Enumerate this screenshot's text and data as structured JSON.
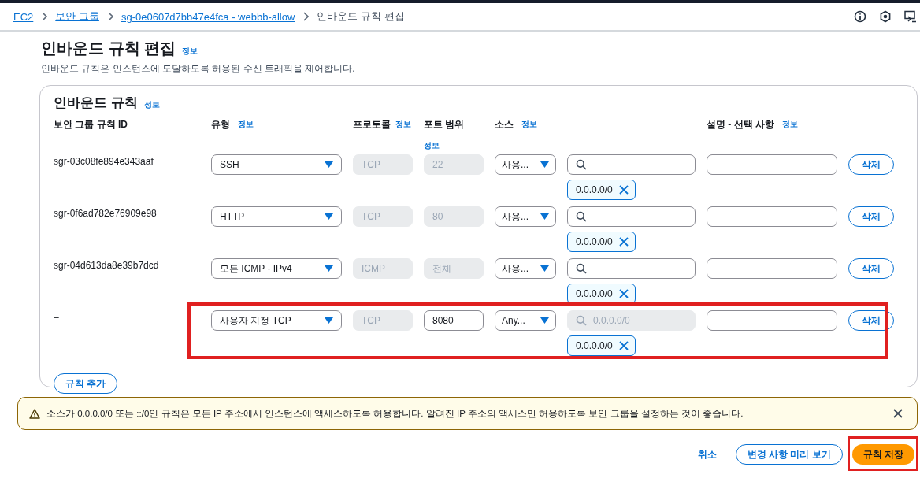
{
  "breadcrumbs": [
    {
      "label": "EC2",
      "link": true
    },
    {
      "label": "보안 그룹",
      "link": true
    },
    {
      "label": "sg-0e0607d7bb47e4fca - webbb-allow",
      "link": true
    },
    {
      "label": "인바운드 규칙 편집",
      "link": false
    }
  ],
  "page": {
    "title": "인바운드 규칙 편집",
    "info": "정보",
    "description": "인바운드 규칙은 인스턴스에 도달하도록 허용된 수신 트래픽을 제어합니다."
  },
  "rules_panel": {
    "title": "인바운드 규칙",
    "info": "정보",
    "columns": [
      {
        "label": "보안 그룹 규칙 ID"
      },
      {
        "label": "유형",
        "info": "정보"
      },
      {
        "label": "프로토콜",
        "info": "정보"
      },
      {
        "label": "포트 범위",
        "info": "정보"
      },
      {
        "label": "소스",
        "info": "정보"
      },
      {
        "label": "설명 - 선택 사항",
        "info": "정보"
      }
    ],
    "rules": [
      {
        "id": "sgr-03c08fe894e343aaf",
        "type": "SSH",
        "protocol": "TCP",
        "port": "22",
        "port_disabled": true,
        "source_type": "사용...",
        "source_disabled": false,
        "chip": "0.0.0.0/0",
        "highlighted": false,
        "delete": "삭제"
      },
      {
        "id": "sgr-0f6ad782e76909e98",
        "type": "HTTP",
        "protocol": "TCP",
        "port": "80",
        "port_disabled": true,
        "source_type": "사용...",
        "source_disabled": false,
        "chip": "0.0.0.0/0",
        "highlighted": false,
        "delete": "삭제"
      },
      {
        "id": "sgr-04d613da8e39b7dcd",
        "type": "모든 ICMP - IPv4",
        "protocol": "ICMP",
        "port": "전체",
        "port_disabled": true,
        "source_type": "사용...",
        "source_disabled": false,
        "chip": "0.0.0.0/0",
        "highlighted": false,
        "delete": "삭제"
      },
      {
        "id": "–",
        "type": "사용자 지정 TCP",
        "protocol": "TCP",
        "port": "8080",
        "port_disabled": false,
        "source_type": "Any...",
        "source_disabled": true,
        "source_placeholder": "0.0.0.0/0",
        "chip": "0.0.0.0/0",
        "highlighted": true,
        "delete": "삭제"
      }
    ],
    "add_button": "규칙 추가"
  },
  "warning": {
    "text": "소스가 0.0.0.0/0 또는 ::/0인 규칙은 모든 IP 주소에서 인스턴스에 액세스하도록 허용합니다. 알려진 IP 주소의 액세스만 허용하도록 보안 그룹을 설정하는 것이 좋습니다."
  },
  "footer": {
    "cancel": "취소",
    "preview": "변경 사항 미리 보기",
    "save": "규칙 저장",
    "save_highlighted": true
  }
}
